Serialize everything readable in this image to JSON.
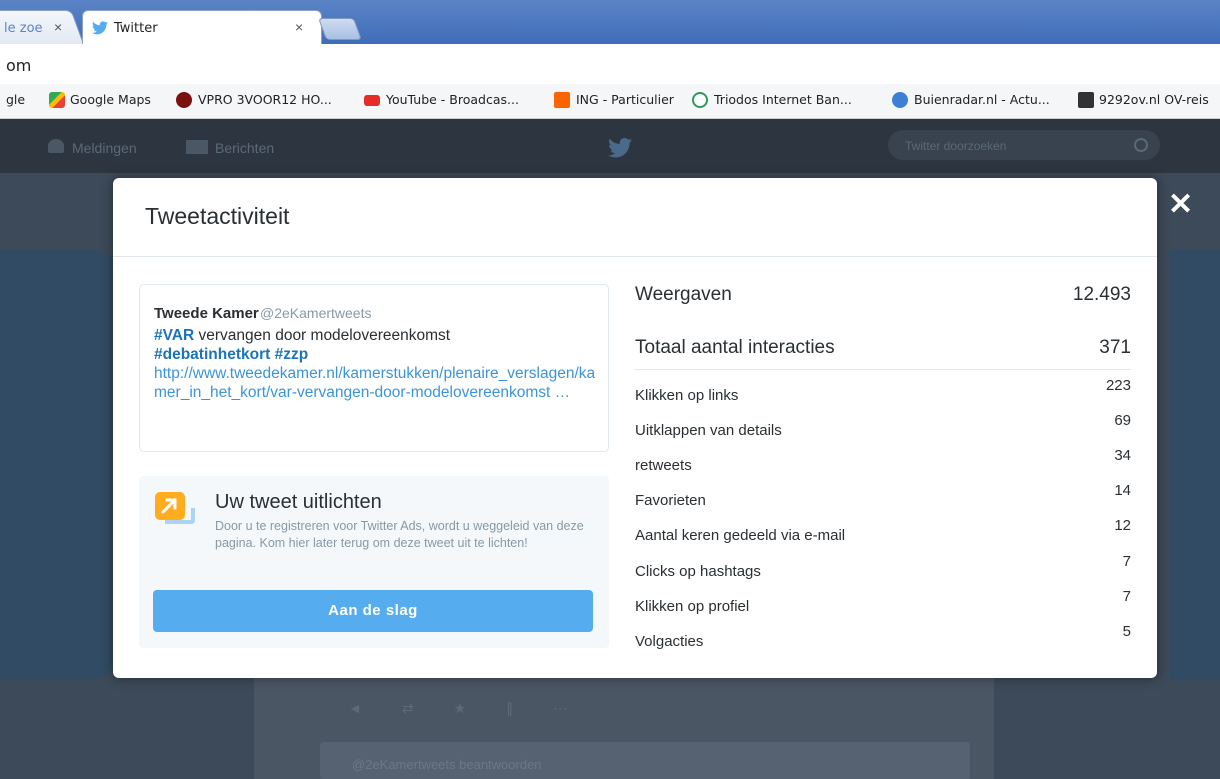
{
  "browser": {
    "tabs": [
      {
        "label": "le zoe",
        "close": "×"
      },
      {
        "label": "Twitter",
        "close": "×"
      }
    ],
    "address": "om",
    "bookmarks": [
      "gle",
      "Google Maps",
      "VPRO 3VOOR12 HO...",
      "YouTube - Broadcas...",
      "ING - Particulier",
      "Triodos Internet Ban...",
      "Buienradar.nl - Actu...",
      "9292ov.nl OV-reis"
    ]
  },
  "twitter_nav": {
    "notifications": "Meldingen",
    "messages": "Berichten",
    "search_placeholder": "Twitter doorzoeken",
    "reply_text": "@2eKamertweets beantwoorden"
  },
  "modal": {
    "title": "Tweetactiviteit",
    "close": "✕",
    "tweet": {
      "author": "Tweede Kamer",
      "handle": "@2eKamertweets",
      "hashtag1": "#VAR",
      "text1": " vervangen door modelovereenkomst",
      "hashtag2": "#debatinhetkort",
      "hashtag3": "#zzp",
      "link": "http://www.tweedekamer.nl/kamerstukken/plenaire_verslagen/kamer_in_het_kort/var-vervangen-door-modelovereenkomst …"
    },
    "promo": {
      "title": "Uw tweet uitlichten",
      "description": "Door u te registreren voor Twitter Ads, wordt u weggeleid van deze pagina. Kom hier later terug om deze tweet uit te lichten!",
      "button": "Aan de slag"
    },
    "stats": {
      "impressions_label": "Weergaven",
      "impressions_value": "12.493",
      "engagements_label": "Totaal aantal interacties",
      "engagements_value": "371",
      "rows": [
        {
          "label": "Klikken op links",
          "value": "223"
        },
        {
          "label": "Uitklappen van details",
          "value": "69"
        },
        {
          "label": "retweets",
          "value": "34"
        },
        {
          "label": "Favorieten",
          "value": "14"
        },
        {
          "label": "Aantal keren gedeeld via e-mail",
          "value": "12"
        },
        {
          "label": "Clicks op hashtags",
          "value": "7"
        },
        {
          "label": "Klikken op profiel",
          "value": "7"
        },
        {
          "label": "Volgacties",
          "value": "5"
        }
      ]
    }
  }
}
